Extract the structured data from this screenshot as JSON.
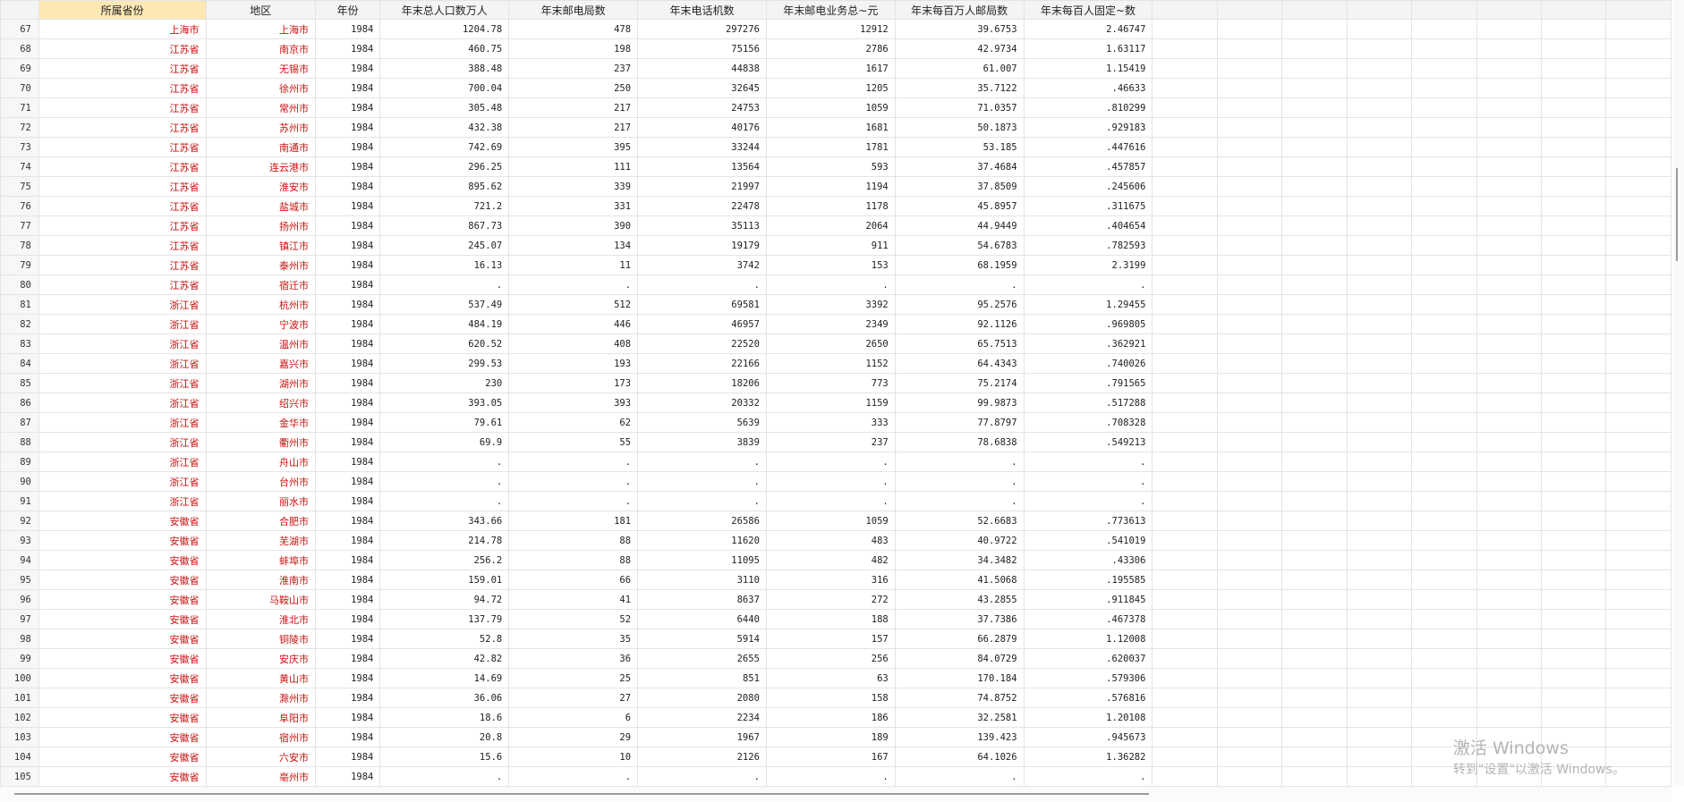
{
  "columns": [
    "",
    "所属省份",
    "地区",
    "年份",
    "年末总人口数万人",
    "年末邮电局数",
    "年末电话机数",
    "年末邮电业务总~元",
    "年末每百万人邮局数",
    "年末每百人固定~数"
  ],
  "selected_column": 1,
  "empty_columns": 8,
  "rows": [
    [
      "67",
      "上海市",
      "上海市",
      "1984",
      "1204.78",
      "478",
      "297276",
      "12912",
      "39.6753",
      "2.46747"
    ],
    [
      "68",
      "江苏省",
      "南京市",
      "1984",
      "460.75",
      "198",
      "75156",
      "2786",
      "42.9734",
      "1.63117"
    ],
    [
      "69",
      "江苏省",
      "无锡市",
      "1984",
      "388.48",
      "237",
      "44838",
      "1617",
      "61.007",
      "1.15419"
    ],
    [
      "70",
      "江苏省",
      "徐州市",
      "1984",
      "700.04",
      "250",
      "32645",
      "1205",
      "35.7122",
      ".46633"
    ],
    [
      "71",
      "江苏省",
      "常州市",
      "1984",
      "305.48",
      "217",
      "24753",
      "1059",
      "71.0357",
      ".810299"
    ],
    [
      "72",
      "江苏省",
      "苏州市",
      "1984",
      "432.38",
      "217",
      "40176",
      "1681",
      "50.1873",
      ".929183"
    ],
    [
      "73",
      "江苏省",
      "南通市",
      "1984",
      "742.69",
      "395",
      "33244",
      "1781",
      "53.185",
      ".447616"
    ],
    [
      "74",
      "江苏省",
      "连云港市",
      "1984",
      "296.25",
      "111",
      "13564",
      "593",
      "37.4684",
      ".457857"
    ],
    [
      "75",
      "江苏省",
      "淮安市",
      "1984",
      "895.62",
      "339",
      "21997",
      "1194",
      "37.8509",
      ".245606"
    ],
    [
      "76",
      "江苏省",
      "盐城市",
      "1984",
      "721.2",
      "331",
      "22478",
      "1178",
      "45.8957",
      ".311675"
    ],
    [
      "77",
      "江苏省",
      "扬州市",
      "1984",
      "867.73",
      "390",
      "35113",
      "2064",
      "44.9449",
      ".404654"
    ],
    [
      "78",
      "江苏省",
      "镇江市",
      "1984",
      "245.07",
      "134",
      "19179",
      "911",
      "54.6783",
      ".782593"
    ],
    [
      "79",
      "江苏省",
      "泰州市",
      "1984",
      "16.13",
      "11",
      "3742",
      "153",
      "68.1959",
      "2.3199"
    ],
    [
      "80",
      "江苏省",
      "宿迁市",
      "1984",
      ".",
      ".",
      ".",
      ".",
      ".",
      "."
    ],
    [
      "81",
      "浙江省",
      "杭州市",
      "1984",
      "537.49",
      "512",
      "69581",
      "3392",
      "95.2576",
      "1.29455"
    ],
    [
      "82",
      "浙江省",
      "宁波市",
      "1984",
      "484.19",
      "446",
      "46957",
      "2349",
      "92.1126",
      ".969805"
    ],
    [
      "83",
      "浙江省",
      "温州市",
      "1984",
      "620.52",
      "408",
      "22520",
      "2650",
      "65.7513",
      ".362921"
    ],
    [
      "84",
      "浙江省",
      "嘉兴市",
      "1984",
      "299.53",
      "193",
      "22166",
      "1152",
      "64.4343",
      ".740026"
    ],
    [
      "85",
      "浙江省",
      "湖州市",
      "1984",
      "230",
      "173",
      "18206",
      "773",
      "75.2174",
      ".791565"
    ],
    [
      "86",
      "浙江省",
      "绍兴市",
      "1984",
      "393.05",
      "393",
      "20332",
      "1159",
      "99.9873",
      ".517288"
    ],
    [
      "87",
      "浙江省",
      "金华市",
      "1984",
      "79.61",
      "62",
      "5639",
      "333",
      "77.8797",
      ".708328"
    ],
    [
      "88",
      "浙江省",
      "衢州市",
      "1984",
      "69.9",
      "55",
      "3839",
      "237",
      "78.6838",
      ".549213"
    ],
    [
      "89",
      "浙江省",
      "舟山市",
      "1984",
      ".",
      ".",
      ".",
      ".",
      ".",
      "."
    ],
    [
      "90",
      "浙江省",
      "台州市",
      "1984",
      ".",
      ".",
      ".",
      ".",
      ".",
      "."
    ],
    [
      "91",
      "浙江省",
      "丽水市",
      "1984",
      ".",
      ".",
      ".",
      ".",
      ".",
      "."
    ],
    [
      "92",
      "安徽省",
      "合肥市",
      "1984",
      "343.66",
      "181",
      "26586",
      "1059",
      "52.6683",
      ".773613"
    ],
    [
      "93",
      "安徽省",
      "芜湖市",
      "1984",
      "214.78",
      "88",
      "11620",
      "483",
      "40.9722",
      ".541019"
    ],
    [
      "94",
      "安徽省",
      "蚌埠市",
      "1984",
      "256.2",
      "88",
      "11095",
      "482",
      "34.3482",
      ".43306"
    ],
    [
      "95",
      "安徽省",
      "淮南市",
      "1984",
      "159.01",
      "66",
      "3110",
      "316",
      "41.5068",
      ".195585"
    ],
    [
      "96",
      "安徽省",
      "马鞍山市",
      "1984",
      "94.72",
      "41",
      "8637",
      "272",
      "43.2855",
      ".911845"
    ],
    [
      "97",
      "安徽省",
      "淮北市",
      "1984",
      "137.79",
      "52",
      "6440",
      "188",
      "37.7386",
      ".467378"
    ],
    [
      "98",
      "安徽省",
      "铜陵市",
      "1984",
      "52.8",
      "35",
      "5914",
      "157",
      "66.2879",
      "1.12008"
    ],
    [
      "99",
      "安徽省",
      "安庆市",
      "1984",
      "42.82",
      "36",
      "2655",
      "256",
      "84.0729",
      ".620037"
    ],
    [
      "100",
      "安徽省",
      "黄山市",
      "1984",
      "14.69",
      "25",
      "851",
      "63",
      "170.184",
      ".579306"
    ],
    [
      "101",
      "安徽省",
      "滁州市",
      "1984",
      "36.06",
      "27",
      "2080",
      "158",
      "74.8752",
      ".576816"
    ],
    [
      "102",
      "安徽省",
      "阜阳市",
      "1984",
      "18.6",
      "6",
      "2234",
      "186",
      "32.2581",
      "1.20108"
    ],
    [
      "103",
      "安徽省",
      "宿州市",
      "1984",
      "20.8",
      "29",
      "1967",
      "189",
      "139.423",
      ".945673"
    ],
    [
      "104",
      "安徽省",
      "六安市",
      "1984",
      "15.6",
      "10",
      "2126",
      "167",
      "64.1026",
      "1.36282"
    ],
    [
      "105",
      "安徽省",
      "亳州市",
      "1984",
      ".",
      ".",
      ".",
      ".",
      ".",
      "."
    ]
  ],
  "watermark": {
    "line1": "激活 Windows",
    "line2": "转到\"设置\"以激活 Windows。"
  }
}
